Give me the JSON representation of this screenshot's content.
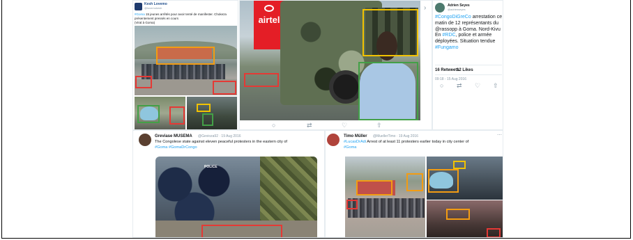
{
  "tweet_top_left": {
    "name": "Kesh Lovemo",
    "handle": "@lovemokesh",
    "text_hashtag": "#Goma",
    "text_body": " 15 jeunes arrêtés pour avoir tenté de manifester. Chokeza présentement pressés en cours",
    "text_line2": "(Viral à Goma)"
  },
  "photo_top_center": {
    "billboard_text": "airtel"
  },
  "tweet_top_right": {
    "name": "Adrien Seyes",
    "handle": "@adrienseyes",
    "text_tag1": "#CongoDiGreCo",
    "text_part1": " arrestation ce matin de 12 représentants du @rassopp à Goma. Nord-Kivu En ",
    "text_tag2": "#RDC",
    "text_part2": ", police et armée déployées. Situation tendue ",
    "text_tag3": "#Fungamo",
    "stats_retweets": "16 Retweets",
    "stats_likes": "12 Likes",
    "timestamp": "09:18 - 15 Aug 2016"
  },
  "tweet_bottom_left": {
    "name": "Greviase MUSEMA",
    "handle": "@Gevioza92 · 19 Aug 2016",
    "text_line1": "The Congolese state against eleven peaceful protesters in the eastern city of",
    "text_tags": "#Goma #GomaDrCongo"
  },
  "photo_bottom_left": {
    "vest_text": "POLICE"
  },
  "tweet_bottom_right": {
    "name": "Timo Müller",
    "handle": "@MuellerTimo · 19 Aug 2016",
    "text_tag1": "#LucasDrAdi",
    "text_body": " Arrest of at least 11 protesters earlier today in city center of",
    "text_tag2": "#Goma"
  },
  "colors": {
    "box_orange": "#f39c12",
    "box_red": "#e53935",
    "box_green": "#43a047",
    "box_yellow": "#f2c200",
    "hashtag": "#1da1f2"
  }
}
